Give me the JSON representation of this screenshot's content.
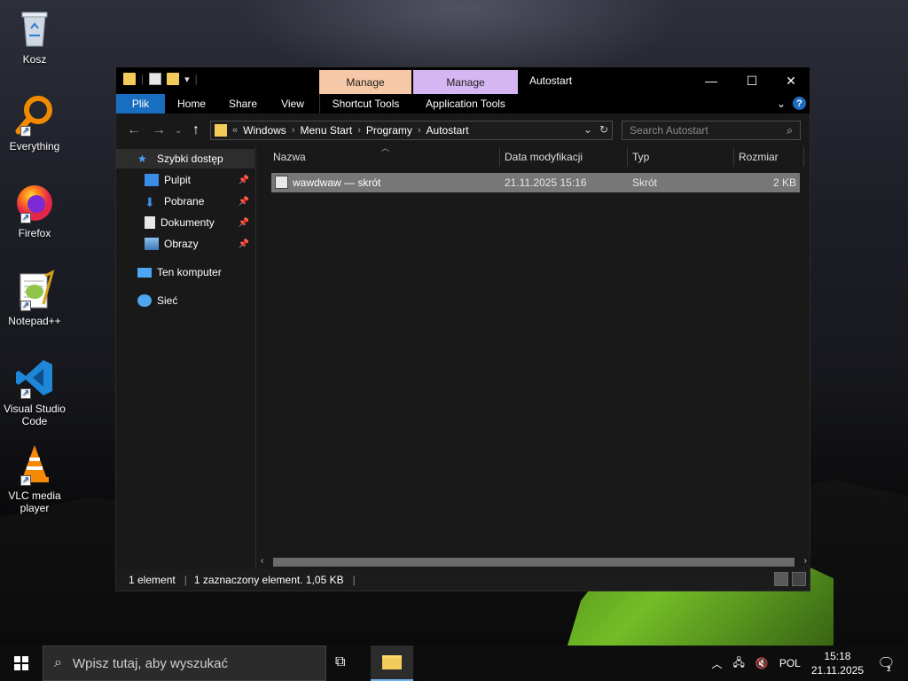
{
  "desktop": {
    "icons": [
      {
        "label": "Kosz",
        "icon": "recycle-bin-icon"
      },
      {
        "label": "Everything",
        "icon": "everything-search-icon"
      },
      {
        "label": "Firefox",
        "icon": "firefox-icon"
      },
      {
        "label": "Notepad++",
        "icon": "notepadpp-icon"
      },
      {
        "label": "Visual Studio Code",
        "icon": "vscode-icon"
      },
      {
        "label": "VLC media player",
        "icon": "vlc-icon"
      }
    ]
  },
  "window": {
    "title": "Autostart",
    "context_tabs": [
      {
        "header": "Manage",
        "label": "Shortcut Tools",
        "color": "#f7c8a8"
      },
      {
        "header": "Manage",
        "label": "Application Tools",
        "color": "#d6b6f2"
      }
    ],
    "ribbon_tabs": [
      "Plik",
      "Home",
      "Share",
      "View"
    ],
    "controls": {
      "minimize": "—",
      "maximize": "☐",
      "close": "✕"
    },
    "breadcrumb": [
      "Windows",
      "Menu Start",
      "Programy",
      "Autostart"
    ],
    "breadcrumb_prefix": "«",
    "search_placeholder": "Search Autostart",
    "nav_pane": {
      "quick_access": "Szybki dostęp",
      "pinned": [
        "Pulpit",
        "Pobrane",
        "Dokumenty",
        "Obrazy"
      ],
      "this_pc": "Ten komputer",
      "network": "Sieć"
    },
    "columns": [
      "Nazwa",
      "Data modyfikacji",
      "Typ",
      "Rozmiar"
    ],
    "files": [
      {
        "name": "wawdwaw — skrót",
        "modified": "21.11.2025 15:16",
        "type": "Skrót",
        "size": "2 KB"
      }
    ],
    "status": {
      "count": "1 element",
      "selected": "1 zaznaczony element. 1,05 KB"
    },
    "accent_color": "#1a6ec2"
  },
  "taskbar": {
    "search_placeholder": "Wpisz tutaj, aby wyszukać",
    "language": "POL",
    "time": "15:18",
    "date": "21.11.2025",
    "notification_count": "1"
  }
}
